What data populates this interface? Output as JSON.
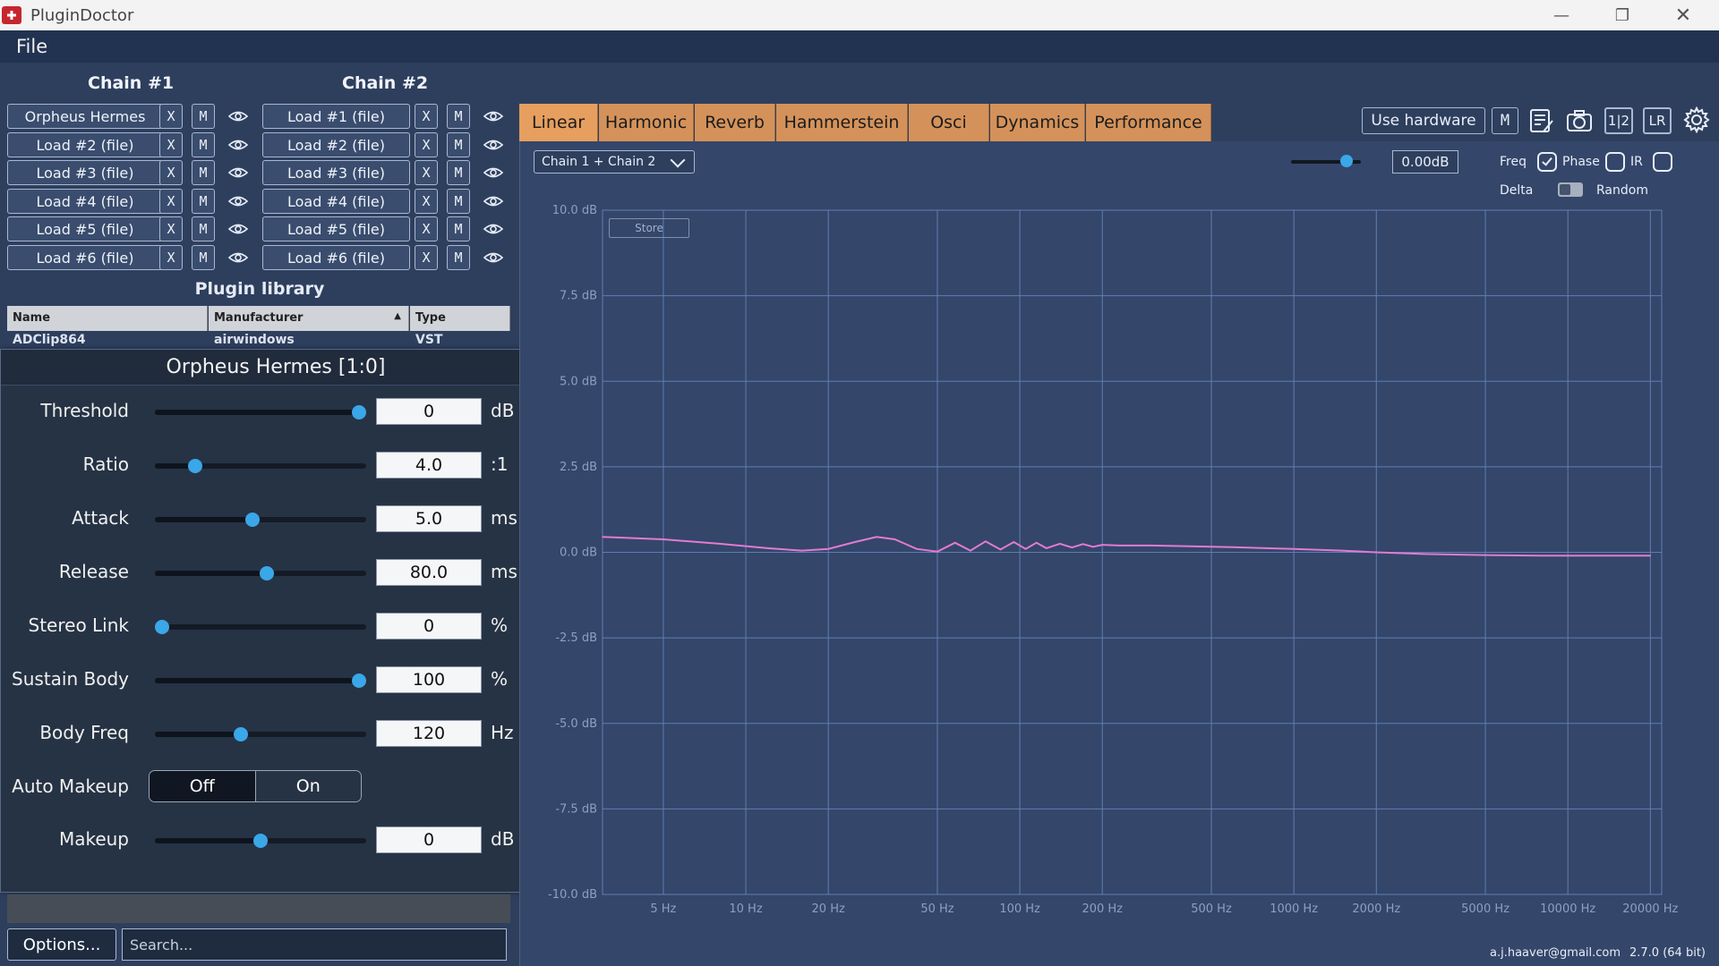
{
  "app": {
    "title": "PluginDoctor"
  },
  "menu": {
    "file": "File"
  },
  "chain1": {
    "title": "Chain #1",
    "slots": [
      "Orpheus Hermes",
      "Load #2 (file)",
      "Load #3 (file)",
      "Load #4 (file)",
      "Load #5 (file)",
      "Load #6 (file)"
    ]
  },
  "chain2": {
    "title": "Chain #2",
    "slots": [
      "Load #1 (file)",
      "Load #2 (file)",
      "Load #3 (file)",
      "Load #4 (file)",
      "Load #5 (file)",
      "Load #6 (file)"
    ]
  },
  "slot_buttons": {
    "remove": "X",
    "mute": "M"
  },
  "library": {
    "title": "Plugin library",
    "columns": [
      "Name",
      "Manufacturer",
      "Type"
    ],
    "sort_indicator": "▲",
    "rows": [
      {
        "name": "ADClip864",
        "manufacturer": "airwindows",
        "type": "VST"
      }
    ]
  },
  "editor": {
    "title": "Orpheus Hermes [1:0]",
    "close": "✕",
    "params": [
      {
        "label": "Threshold",
        "value": "0",
        "unit": "dB",
        "level": 1.0
      },
      {
        "label": "Ratio",
        "value": "4.0",
        "unit": ":1",
        "level": 0.17
      },
      {
        "label": "Attack",
        "value": "5.0",
        "unit": "ms",
        "level": 0.46
      },
      {
        "label": "Release",
        "value": "80.0",
        "unit": "ms",
        "level": 0.53
      },
      {
        "label": "Stereo Link",
        "value": "0",
        "unit": "%",
        "level": 0.0
      },
      {
        "label": "Sustain Body",
        "value": "100",
        "unit": "%",
        "level": 1.0
      },
      {
        "label": "Body Freq",
        "value": "120",
        "unit": "Hz",
        "level": 0.4
      }
    ],
    "auto_makeup": {
      "label": "Auto Makeup",
      "off": "Off",
      "on": "On",
      "selected": "Off"
    },
    "makeup": {
      "label": "Makeup",
      "value": "0",
      "unit": "dB",
      "level": 0.5
    }
  },
  "bottom": {
    "options": "Options...",
    "search_placeholder": "Search..."
  },
  "tabs": [
    "Linear",
    "Harmonic",
    "Reverb",
    "Hammerstein",
    "Osci",
    "Dynamics",
    "Performance"
  ],
  "active_tab": "Linear",
  "toolbar": {
    "use_hardware": "Use hardware",
    "mute": "M",
    "ratio_label": "1|2",
    "lr_label": "LR"
  },
  "graph_controls": {
    "chain_select": "Chain 1 + Chain 2",
    "gain_value": "0.00dB",
    "gain_level": 0.8,
    "freq": "Freq",
    "phase": "Phase",
    "ir": "IR",
    "delta": "Delta",
    "random": "Random",
    "freq_checked": true,
    "phase_checked": false,
    "ir_checked": false,
    "store": "Store"
  },
  "chart_data": {
    "type": "line",
    "title": "",
    "xlabel": "",
    "ylabel": "",
    "x_scale": "log",
    "xlim": [
      3,
      22000
    ],
    "ylim": [
      -10,
      10
    ],
    "x_ticks": [
      {
        "value": 5,
        "label": "5 Hz"
      },
      {
        "value": 10,
        "label": "10 Hz"
      },
      {
        "value": 20,
        "label": "20 Hz"
      },
      {
        "value": 50,
        "label": "50 Hz"
      },
      {
        "value": 100,
        "label": "100 Hz"
      },
      {
        "value": 200,
        "label": "200 Hz"
      },
      {
        "value": 500,
        "label": "500 Hz"
      },
      {
        "value": 1000,
        "label": "1000 Hz"
      },
      {
        "value": 2000,
        "label": "2000 Hz"
      },
      {
        "value": 5000,
        "label": "5000 Hz"
      },
      {
        "value": 10000,
        "label": "10000 Hz"
      },
      {
        "value": 20000,
        "label": "20000 Hz"
      }
    ],
    "y_ticks": [
      {
        "value": 10,
        "label": "10.0 dB"
      },
      {
        "value": 7.5,
        "label": "7.5 dB"
      },
      {
        "value": 5,
        "label": "5.0 dB"
      },
      {
        "value": 2.5,
        "label": "2.5 dB"
      },
      {
        "value": 0,
        "label": "0.0 dB"
      },
      {
        "value": -2.5,
        "label": "-2.5 dB"
      },
      {
        "value": -5,
        "label": "-5.0 dB"
      },
      {
        "value": -7.5,
        "label": "-7.5 dB"
      },
      {
        "value": -10,
        "label": "-10.0 dB"
      }
    ],
    "grid": true,
    "series": [
      {
        "color": "#e27bd0",
        "x": [
          3,
          5,
          8,
          12,
          16,
          20,
          25,
          30,
          35,
          42,
          50,
          58,
          66,
          75,
          85,
          95,
          105,
          115,
          125,
          140,
          155,
          170,
          185,
          200,
          230,
          260,
          300,
          400,
          600,
          1000,
          1500,
          2000,
          3000,
          5000,
          8000,
          12000,
          20000
        ],
        "y": [
          0.45,
          0.38,
          0.25,
          0.12,
          0.05,
          0.1,
          0.3,
          0.45,
          0.38,
          0.1,
          0.02,
          0.28,
          0.05,
          0.32,
          0.08,
          0.3,
          0.1,
          0.28,
          0.12,
          0.25,
          0.14,
          0.24,
          0.16,
          0.22,
          0.2,
          0.2,
          0.2,
          0.18,
          0.15,
          0.1,
          0.05,
          0.0,
          -0.05,
          -0.08,
          -0.1,
          -0.1,
          -0.1
        ]
      }
    ]
  },
  "footer": {
    "email": "a.j.haaver@gmail.com",
    "version": "2.7.0 (64 bit)"
  },
  "colors": {
    "accent": "#3aa7e8",
    "tab": "#d4925a",
    "curve": "#e27bd0",
    "background": "#34466a"
  }
}
